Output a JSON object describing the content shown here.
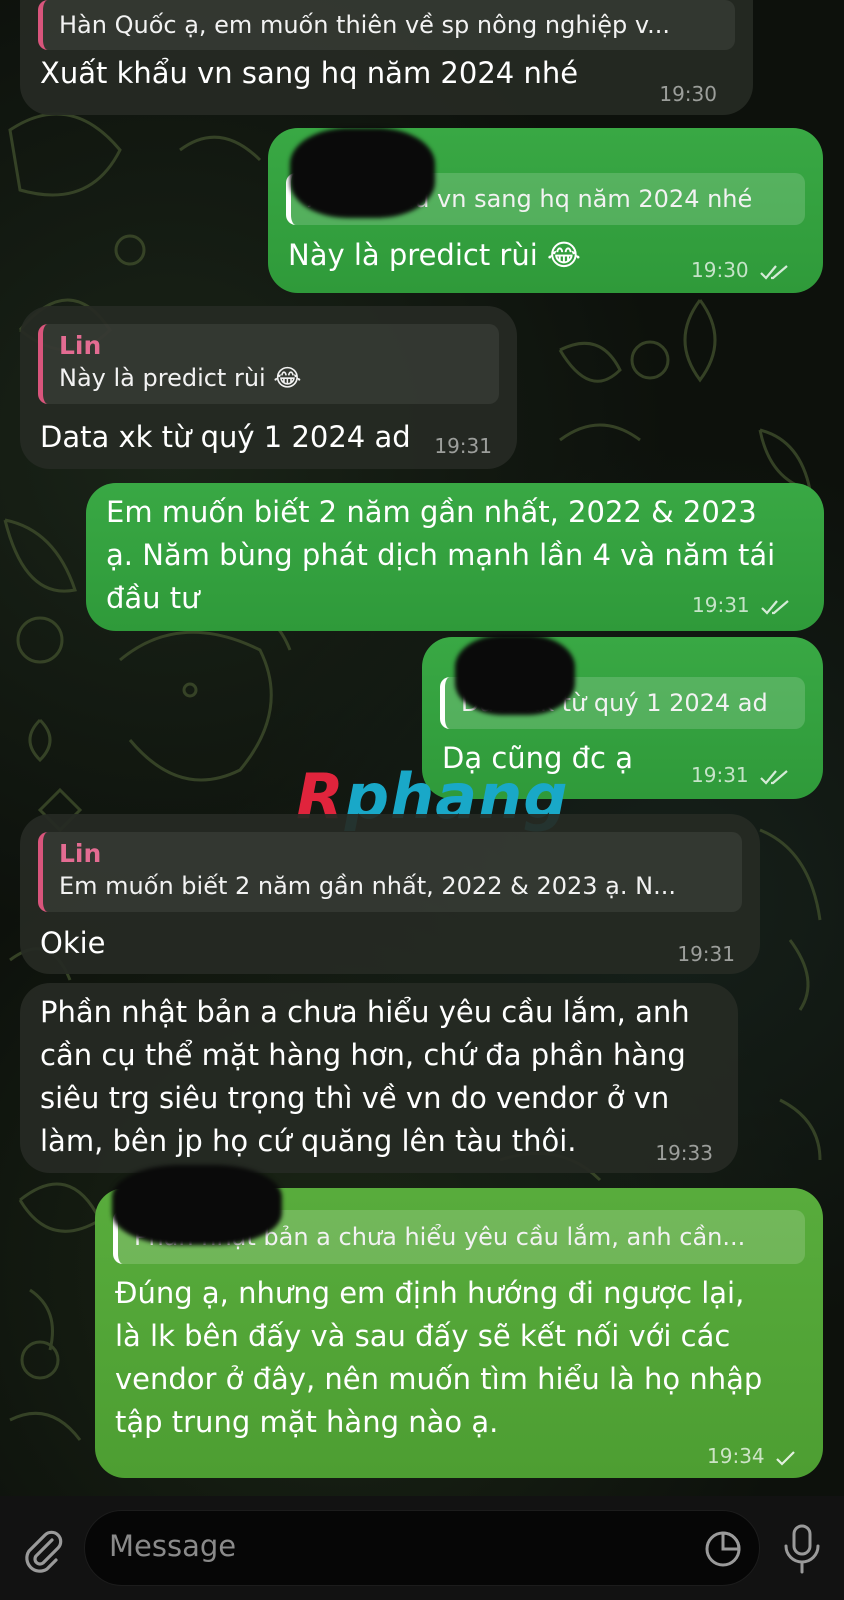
{
  "messages": [
    {
      "side": "in",
      "reply_text": "Hàn Quốc ạ, em muốn thiên về sp nông nghiệp v...",
      "text": "Xuất khẩu vn sang hq năm 2024 nhé",
      "time": "19:30"
    },
    {
      "side": "out",
      "reply_text": "Xuất khẩu vn sang hq năm 2024 nhé",
      "text": "Này là predict rùi 😂",
      "time": "19:30",
      "status": "read"
    },
    {
      "side": "in",
      "reply_name": "Lin",
      "reply_text": "Này là predict rùi 😂",
      "text": "Data xk từ quý 1 2024 ad",
      "time": "19:31"
    },
    {
      "side": "out",
      "lines": [
        "Em muốn biết 2 năm gần nhất, 2022 & 2023",
        "ạ. Năm bùng phát dịch mạnh lần 4 và năm tái",
        "đầu tư"
      ],
      "time": "19:31",
      "status": "read"
    },
    {
      "side": "out",
      "reply_text": "Data xk từ quý 1 2024 ad",
      "text": "Dạ cũng đc ạ",
      "time": "19:31",
      "status": "read"
    },
    {
      "side": "in",
      "reply_name": "Lin",
      "reply_text": "Em muốn biết 2 năm gần nhất, 2022 & 2023 ạ. N...",
      "text": "Okie",
      "time": "19:31"
    },
    {
      "side": "in",
      "lines": [
        "Phần nhật bản a chưa hiểu yêu cầu lắm, anh",
        "cần cụ thể mặt hàng hơn, chứ đa phần hàng",
        "siêu trg siêu trọng thì về vn do vendor ở vn",
        "làm, bên jp họ cứ quăng lên tàu thôi."
      ],
      "time": "19:33"
    },
    {
      "side": "out",
      "reply_text": "Phần nhật bản a chưa hiểu yêu cầu lắm, anh cần...",
      "lines": [
        "Đúng ạ, nhưng em định hướng đi ngược lại,",
        "là lk bên đấy và sau đấy sẽ kết nối với các",
        "vendor ở đây, nên muốn tìm hiểu là họ nhập",
        "tập trung mặt hàng nào ạ."
      ],
      "time": "19:34",
      "status": "sent"
    }
  ],
  "watermark": {
    "first": "R",
    "rest": "phang"
  },
  "composer": {
    "placeholder": "Message"
  },
  "icons": {
    "attach": "paperclip-icon",
    "sticker": "sticker-icon",
    "mic": "microphone-icon"
  },
  "colors": {
    "outgoing": "#37a441",
    "outgoing_last": "#55a83a",
    "incoming": "#262a24",
    "reply_accent": "#e36c92"
  }
}
